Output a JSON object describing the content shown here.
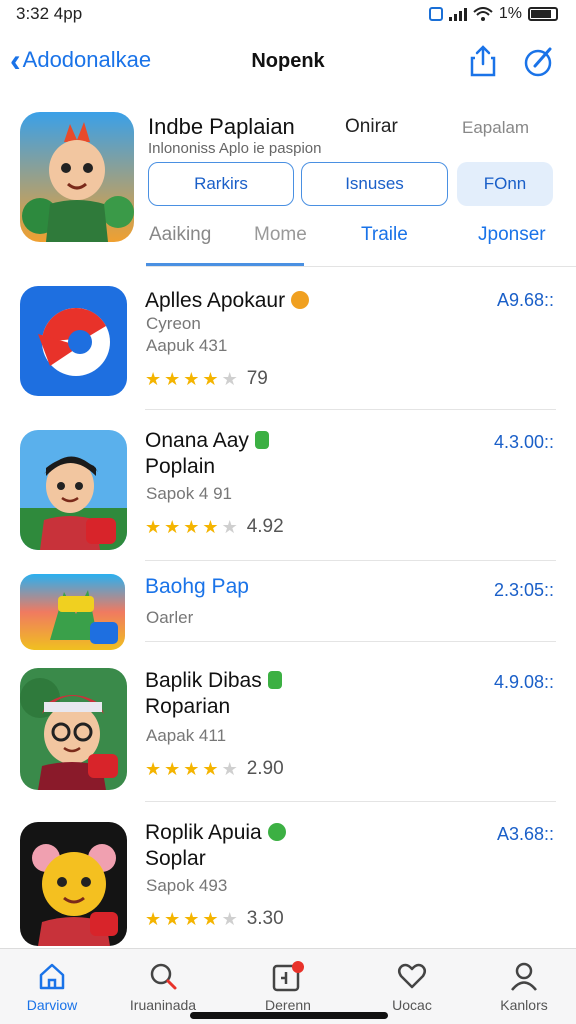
{
  "status_bar": {
    "time": "3:32 4pp",
    "battery": "1%"
  },
  "nav": {
    "back_label": "Adodonalkae",
    "title": "Nopenk"
  },
  "hero": {
    "title": "Indbe Paplaian",
    "online": "Onirar",
    "right_label": "Eapalam",
    "subtitle": "Inlononiss Aplo ie paspion",
    "filters": [
      "Rarkirs",
      "Isnuses",
      "FOnn"
    ],
    "tabs": [
      "Aaiking",
      "Mome",
      "Traile",
      "Jponser"
    ]
  },
  "apps": [
    {
      "name_lines": [
        "Aplles Apokaur"
      ],
      "subs": [
        "Cyreon",
        "Aapuk 431"
      ],
      "stars": 4,
      "rating": "79",
      "time": "A9.68::",
      "badge_color": "#f0a020",
      "icon": "icon-apps-1"
    },
    {
      "name_lines": [
        "Onana Aay",
        "Poplain"
      ],
      "subs": [
        "Sapok 4 91"
      ],
      "stars": 4,
      "rating": "4.92",
      "time": "4.3.00::",
      "badge_color": "#3cb043",
      "icon": "icon-apps-2"
    },
    {
      "name_lines": [
        "Baohg Pap"
      ],
      "subs": [
        "Oarler"
      ],
      "stars": 0,
      "rating": "",
      "time": "2.3:05::",
      "badge_color": "",
      "icon": "icon-apps-3",
      "name_color": "#1a73e8"
    },
    {
      "name_lines": [
        "Baplik Dibas",
        "Roparian"
      ],
      "subs": [
        "Aapak 411"
      ],
      "stars": 4,
      "rating": "2.90",
      "time": "4.9.08::",
      "badge_color": "#3cb043",
      "icon": "icon-apps-4"
    },
    {
      "name_lines": [
        "Roplik Apuia",
        "Soplar"
      ],
      "subs": [
        "Sapok 493"
      ],
      "stars": 4,
      "rating": "3.30",
      "time": "A3.68::",
      "badge_color": "#3cb043",
      "icon": "icon-apps-5"
    }
  ],
  "tab_bar": {
    "items": [
      {
        "label": "Darviow",
        "icon": "home-icon"
      },
      {
        "label": "Iruaninada",
        "icon": "search-icon"
      },
      {
        "label": "Derenn",
        "icon": "updates-icon"
      },
      {
        "label": "Uocac",
        "icon": "heart-icon"
      },
      {
        "label": "Kanlors",
        "icon": "person-icon"
      }
    ]
  },
  "colors": {
    "accent": "#1a73e8",
    "star": "#f4b400"
  }
}
